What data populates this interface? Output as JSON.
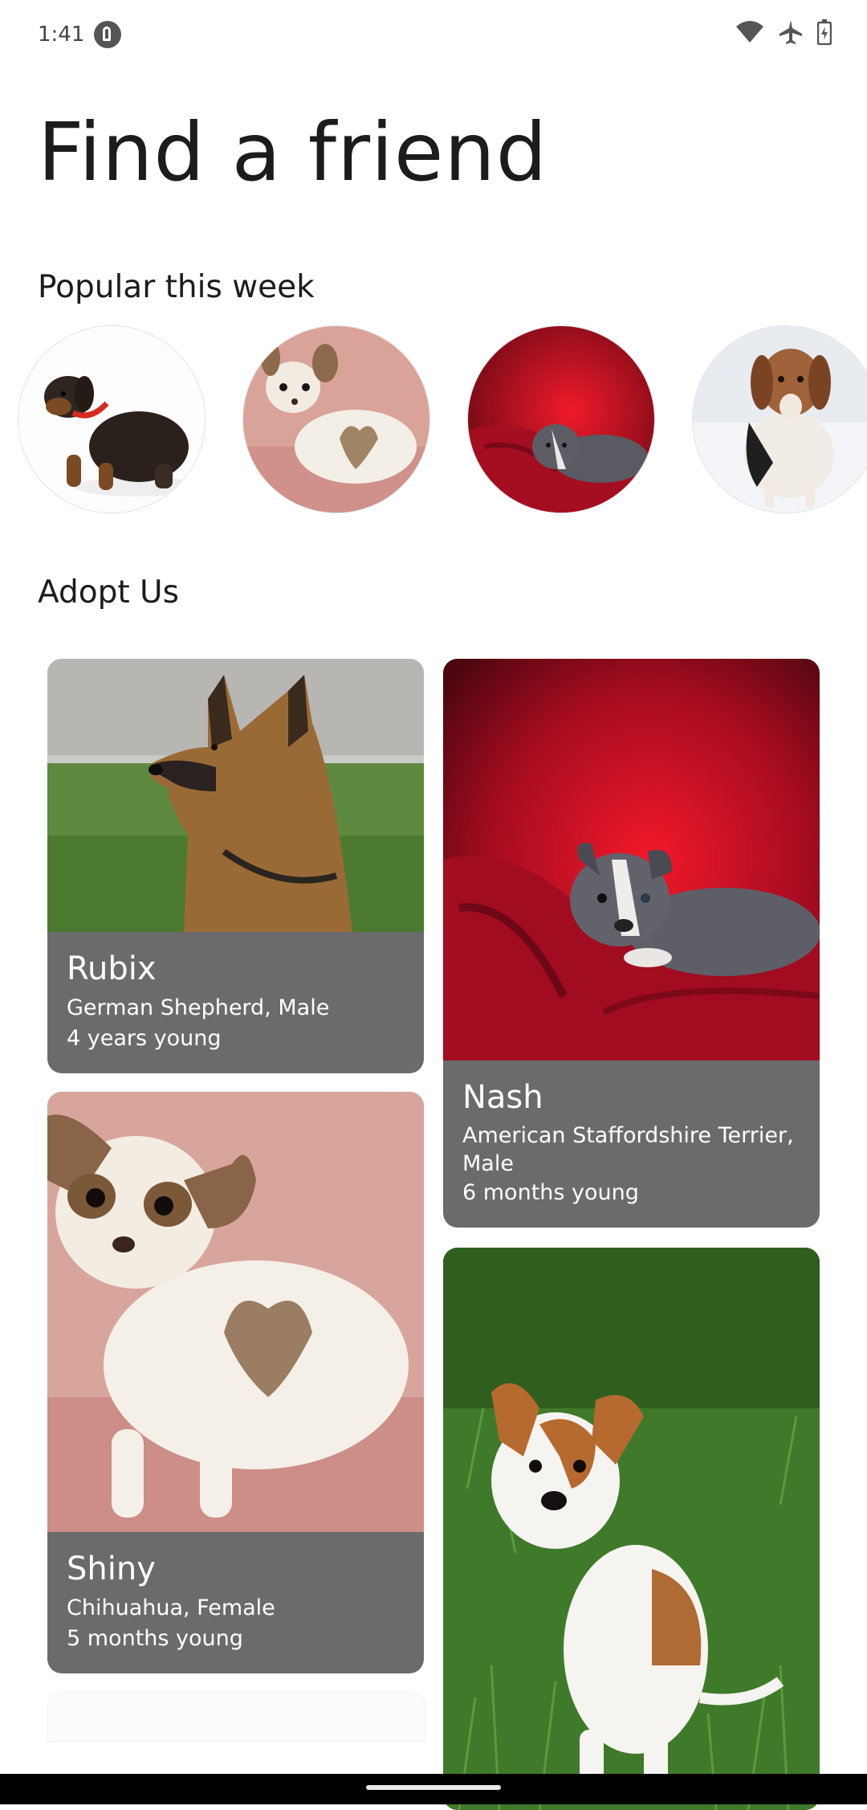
{
  "status_bar": {
    "time": "1:41",
    "icons": [
      "app-notification-icon",
      "wifi-icon",
      "airplane-mode-icon",
      "battery-charging-icon"
    ]
  },
  "title": "Find a friend",
  "popular": {
    "heading": "Popular this week",
    "items": [
      {
        "image": "dachshund-puppy-photo"
      },
      {
        "image": "chihuahua-puppy-photo"
      },
      {
        "image": "staffordshire-puppy-photo"
      },
      {
        "image": "beagle-photo"
      }
    ]
  },
  "adopt": {
    "heading": "Adopt Us",
    "cards": [
      {
        "name": "Rubix",
        "breed": "German Shepherd, Male",
        "age": "4 years young",
        "image": "german-shepherd-photo"
      },
      {
        "name": "Nash",
        "breed": "American Staffordshire Terrier, Male",
        "age": "6 months young",
        "image": "staffordshire-puppy-photo"
      },
      {
        "name": "Shiny",
        "breed": "Chihuahua, Female",
        "age": "5 months young",
        "image": "chihuahua-puppy-photo"
      },
      {
        "name": "",
        "breed": "",
        "age": "",
        "image": "jack-russell-puppy-photo"
      }
    ]
  },
  "colors": {
    "card_background": "#6b6b6b",
    "text_primary": "#1c1c1c",
    "card_text": "#ffffff"
  }
}
